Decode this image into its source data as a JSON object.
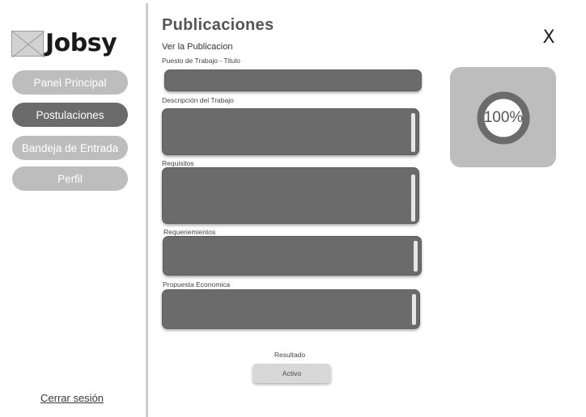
{
  "brand": {
    "name": "Jobsy",
    "logo_icon": "image-placeholder-icon"
  },
  "sidebar": {
    "items": [
      {
        "label": "Panel Principal",
        "active": false
      },
      {
        "label": "Postulaciones",
        "active": true
      },
      {
        "label": "Bandeja de Entrada",
        "active": false
      },
      {
        "label": "Perfil",
        "active": false
      }
    ],
    "logout_label": "Cerrar sesión"
  },
  "main": {
    "title": "Publicaciones",
    "subtitle": "Ver la Publicacion",
    "close_icon": "close-icon",
    "close_label": "X",
    "fields": [
      {
        "label": "Puesto de Trabajo - Titulo",
        "value": ""
      },
      {
        "label": "Descripción del Trabajo",
        "value": ""
      },
      {
        "label": "Requisitos",
        "value": ""
      },
      {
        "label": "Requeriemientos",
        "value": ""
      },
      {
        "label": "Propuesta Economica",
        "value": ""
      }
    ],
    "result_label": "Resultado",
    "status_label": "Activo"
  },
  "progress": {
    "value": 100,
    "label": "100%"
  },
  "colors": {
    "field_fill": "#6b6b6b",
    "button_inactive": "#bdbdbd",
    "button_active": "#6b6b6b",
    "card_bg": "#bdbdbd",
    "ring": "#6b6b6b"
  }
}
